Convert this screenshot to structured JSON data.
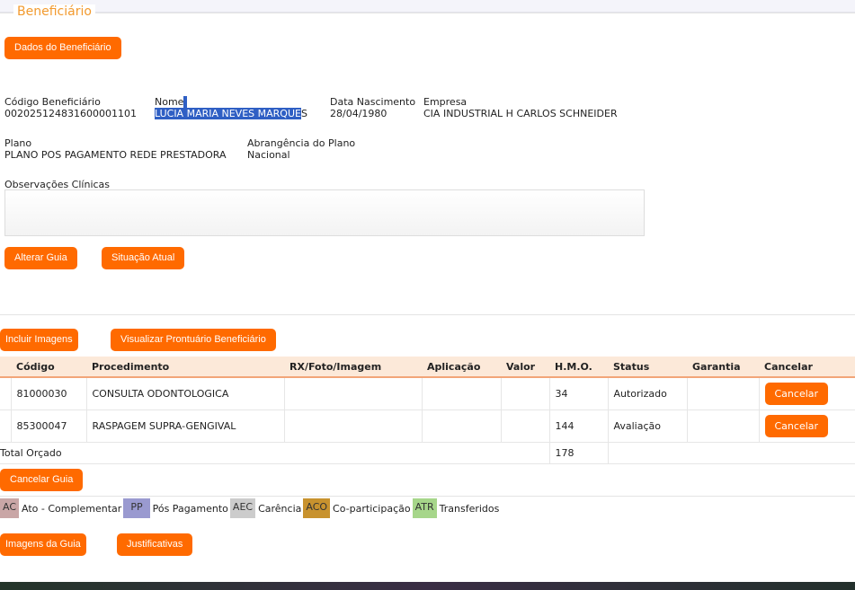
{
  "section_title": "Beneficiário",
  "buttons": {
    "dados": "Dados do Beneficiário",
    "alterar": "Alterar Guia",
    "situacao": "Situação Atual",
    "incluir": "Incluir Imagens",
    "prontuario": "Visualizar Prontuário Beneficiário",
    "cancelar_guia": "Cancelar Guia",
    "imagens": "Imagens da Guia",
    "justificativas": "Justificativas"
  },
  "beneficiario": {
    "codigo_label": "Código Beneficiário",
    "codigo": "00202512483160000110​1",
    "nome_label": "Nome",
    "nome_selected": "LUCIA MARIA NEVES MARQUE",
    "nome_rest": "S",
    "nasc_label": "Data Nascimento",
    "nasc": "28/04/1980",
    "empresa_label": "Empresa",
    "empresa": "CIA INDUSTRIAL H CARLOS SCHNEIDER",
    "plano_label": "Plano",
    "plano": "PLANO POS PAGAMENTO REDE PRESTADORA",
    "abrang_label": "Abrangência do Plano",
    "abrang": "Nacional",
    "obs_label": "Observações Clínicas"
  },
  "table": {
    "headers": [
      "Código",
      "Procedimento",
      "RX/Foto/Imagem",
      "Aplicação",
      "Valor",
      "H.M.O.",
      "Status",
      "Garantia",
      "Cancelar"
    ],
    "rows": [
      {
        "codigo": "81000030",
        "proc": "CONSULTA ODONTOLOGICA",
        "hmo": "34",
        "status": "Autorizado",
        "cancel": "Cancelar"
      },
      {
        "codigo": "85300047",
        "proc": "RASPAGEM SUPRA-GENGIVAL",
        "hmo": "144",
        "status": "Avaliação",
        "cancel": "Cancelar"
      }
    ],
    "total_label": "Total Orçado",
    "total_hmo": "178"
  },
  "legend": [
    {
      "code": "AC",
      "label": "Ato - Complementar",
      "color": "#c9a6a6"
    },
    {
      "code": "PP",
      "label": "Pós Pagamento",
      "color": "#9a9ad0"
    },
    {
      "code": "AEC",
      "label": "Carência",
      "color": "#cccccc"
    },
    {
      "code": "ACO",
      "label": "Co-participação",
      "color": "#c8922e"
    },
    {
      "code": "ATR",
      "label": "Transferidos",
      "color": "#a6d68a"
    }
  ]
}
